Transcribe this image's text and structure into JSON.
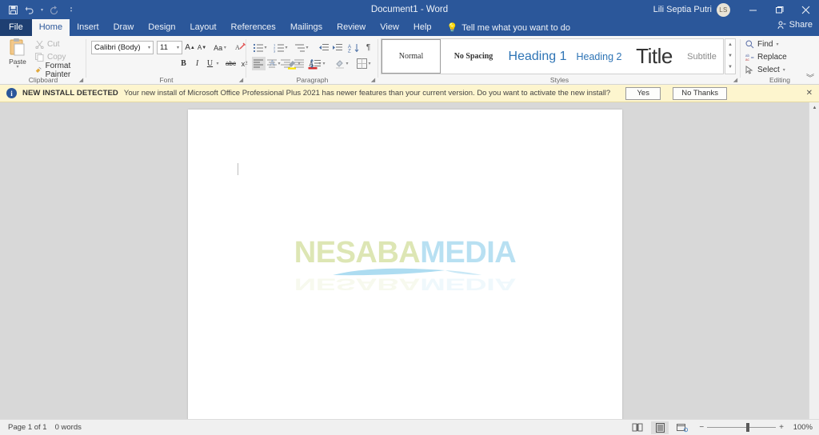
{
  "titlebar": {
    "document_title": "Document1  -  Word",
    "quick_access": [
      {
        "name": "save",
        "label": "Save"
      },
      {
        "name": "undo",
        "label": "Undo"
      },
      {
        "name": "redo",
        "label": "Redo"
      },
      {
        "name": "customize",
        "label": "Customize Quick Access Toolbar"
      }
    ],
    "user_name": "Lili Septia Putri",
    "avatar_initials": "LS",
    "window_buttons": [
      "Minimize",
      "Restore Down",
      "Close"
    ],
    "background_color": "#2b579a"
  },
  "tabs": [
    {
      "label": "File",
      "active": false,
      "file": true
    },
    {
      "label": "Home",
      "active": true,
      "file": false
    },
    {
      "label": "Insert",
      "active": false,
      "file": false
    },
    {
      "label": "Draw",
      "active": false,
      "file": false
    },
    {
      "label": "Design",
      "active": false,
      "file": false
    },
    {
      "label": "Layout",
      "active": false,
      "file": false
    },
    {
      "label": "References",
      "active": false,
      "file": false
    },
    {
      "label": "Mailings",
      "active": false,
      "file": false
    },
    {
      "label": "Review",
      "active": false,
      "file": false
    },
    {
      "label": "View",
      "active": false,
      "file": false
    },
    {
      "label": "Help",
      "active": false,
      "file": false
    }
  ],
  "tell_me": {
    "placeholder": "Tell me what you want to do"
  },
  "share": {
    "label": "Share"
  },
  "ribbon": {
    "groups": [
      {
        "name": "clipboard",
        "label": "Clipboard"
      },
      {
        "name": "font",
        "label": "Font"
      },
      {
        "name": "paragraph",
        "label": "Paragraph"
      },
      {
        "name": "styles",
        "label": "Styles"
      },
      {
        "name": "editing",
        "label": "Editing"
      }
    ],
    "clipboard": {
      "paste_label": "Paste",
      "cut_label": "Cut",
      "copy_label": "Copy",
      "format_painter_label": "Format Painter"
    },
    "font": {
      "font_name": "Calibri (Body)",
      "font_size": "11",
      "buttons": [
        "Grow Font",
        "Shrink Font",
        "Change Case",
        "Clear All Formatting",
        "Bold",
        "Italic",
        "Underline",
        "Strikethrough",
        "Subscript",
        "Superscript",
        "Text Effects and Typography",
        "Text Highlight Color",
        "Font Color"
      ]
    },
    "paragraph": {
      "buttons": [
        "Bullets",
        "Numbering",
        "Multilevel List",
        "Decrease Indent",
        "Increase Indent",
        "Sort",
        "Show/Hide Formatting Marks",
        "Align Left",
        "Center",
        "Align Right",
        "Justify",
        "Line and Paragraph Spacing",
        "Shading",
        "Borders"
      ]
    },
    "styles": {
      "items": [
        {
          "label": "Normal",
          "selected": true
        },
        {
          "label": "No Spacing",
          "selected": false
        },
        {
          "label": "Heading 1",
          "selected": false
        },
        {
          "label": "Heading 2",
          "selected": false
        },
        {
          "label": "Title",
          "selected": false
        },
        {
          "label": "Subtitle",
          "selected": false
        }
      ]
    },
    "editing": {
      "find_label": "Find",
      "replace_label": "Replace",
      "select_label": "Select"
    }
  },
  "notification": {
    "title": "NEW INSTALL DETECTED",
    "message": "Your new install of Microsoft Office Professional Plus 2021 has newer features than your current version. Do you want to activate the new install?",
    "primary_button": "Yes",
    "secondary_button": "No Thanks",
    "background_color": "#fdf5ce"
  },
  "document": {
    "watermark_part_one": "NESABA",
    "watermark_part_two": "MEDIA",
    "watermark_color_one": "#dde6b4",
    "watermark_color_two": "#b8e0f2"
  },
  "statusbar": {
    "page_info": "Page 1 of 1",
    "word_count": "0 words",
    "view_modes": [
      {
        "name": "read-mode",
        "label": "Read Mode",
        "active": false
      },
      {
        "name": "print-layout",
        "label": "Print Layout",
        "active": true
      },
      {
        "name": "web-layout",
        "label": "Web Layout",
        "active": false
      }
    ],
    "zoom_out": "−",
    "zoom_in": "+",
    "zoom_level": "100%"
  }
}
